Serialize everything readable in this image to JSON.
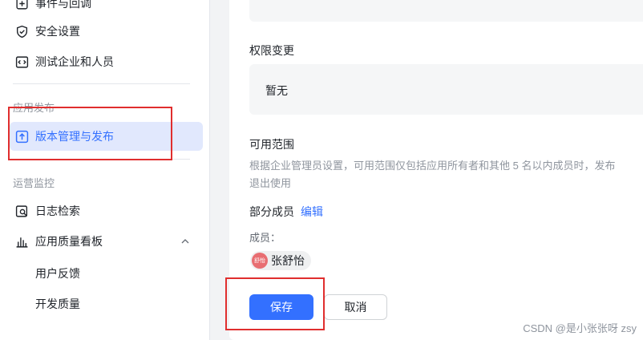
{
  "sidebar": {
    "items": [
      {
        "label": "事件与回调"
      },
      {
        "label": "安全设置"
      },
      {
        "label": "测试企业和人员"
      }
    ],
    "section_publish": "应用发布",
    "active_item": "版本管理与发布",
    "section_monitor": "运营监控",
    "monitor_items": [
      {
        "label": "日志检索"
      },
      {
        "label": "应用质量看板"
      }
    ],
    "sub_items": [
      "用户反馈",
      "开发质量"
    ]
  },
  "main": {
    "permission_title": "权限变更",
    "permission_value": "暂无",
    "scope_title": "可用范围",
    "scope_desc_line1": "根据企业管理员设置，可用范围仅包括应用所有者和其他 5 名以内成员时，发布",
    "scope_desc_line2": "退出使用",
    "partial_members": "部分成员",
    "edit_link": "编辑",
    "members_label": "成员：",
    "member_name": "张舒怡",
    "avatar_text": "舒怡",
    "save_button": "保存",
    "cancel_button": "取消"
  },
  "watermark": "CSDN @是小张张呀 zsy",
  "colors": {
    "accent": "#3370ff",
    "highlight_box": "#e02e2e",
    "active_bg": "#e1e8fd"
  }
}
